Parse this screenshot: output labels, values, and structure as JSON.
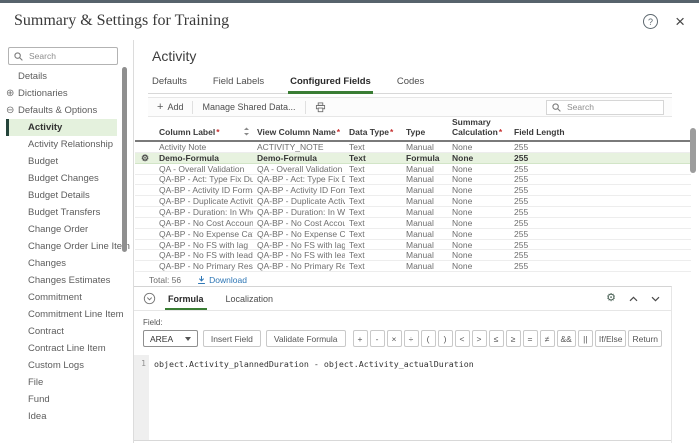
{
  "window": {
    "title": "Summary & Settings for Training"
  },
  "colors": {
    "accent_green": "#3a7d34",
    "selected_row_bg": "#e7f2df",
    "link_blue": "#2d76b5",
    "required_red": "#c62f2f",
    "selection_bar": "#25443b"
  },
  "sidebar": {
    "search_placeholder": "Search",
    "items": [
      {
        "label": "Details",
        "level": 1
      },
      {
        "label": "Dictionaries",
        "level": 1,
        "icon": "plus-circle"
      },
      {
        "label": "Defaults & Options",
        "level": 1,
        "icon": "minus-circle"
      },
      {
        "label": "Activity",
        "level": 2,
        "selected": true
      },
      {
        "label": "Activity Relationship",
        "level": 2
      },
      {
        "label": "Budget",
        "level": 2
      },
      {
        "label": "Budget Changes",
        "level": 2
      },
      {
        "label": "Budget Details",
        "level": 2
      },
      {
        "label": "Budget Transfers",
        "level": 2
      },
      {
        "label": "Change Order",
        "level": 2
      },
      {
        "label": "Change Order Line Item",
        "level": 2
      },
      {
        "label": "Changes",
        "level": 2
      },
      {
        "label": "Changes Estimates",
        "level": 2
      },
      {
        "label": "Commitment",
        "level": 2
      },
      {
        "label": "Commitment Line Item",
        "level": 2
      },
      {
        "label": "Contract",
        "level": 2
      },
      {
        "label": "Contract Line Item",
        "level": 2
      },
      {
        "label": "Custom Logs",
        "level": 2
      },
      {
        "label": "File",
        "level": 2
      },
      {
        "label": "Fund",
        "level": 2
      },
      {
        "label": "Idea",
        "level": 2
      }
    ]
  },
  "main": {
    "title": "Activity",
    "tabs": [
      {
        "label": "Defaults"
      },
      {
        "label": "Field Labels"
      },
      {
        "label": "Configured Fields",
        "active": true
      },
      {
        "label": "Codes"
      }
    ],
    "toolbar": {
      "add_label": "Add",
      "manage_label": "Manage Shared Data...",
      "search_placeholder": "Search"
    },
    "table": {
      "columns": [
        {
          "label": "Column Label",
          "required": true,
          "sortable": true
        },
        {
          "label": "View Column Name",
          "required": true
        },
        {
          "label": "Data Type",
          "required": true
        },
        {
          "label": "Type"
        },
        {
          "label": "Summary Calculation",
          "required": true
        },
        {
          "label": "Field Length"
        }
      ],
      "rows": [
        {
          "cells": [
            "Activity Note",
            "ACTIVITY_NOTE",
            "Text",
            "Manual",
            "None",
            "255"
          ]
        },
        {
          "cells": [
            "Demo-Formula",
            "Demo-Formula",
            "Text",
            "Formula",
            "None",
            "255"
          ],
          "selected": true,
          "gear": true
        },
        {
          "cells": [
            "QA - Overall Validation",
            "QA - Overall Validation",
            "Text",
            "Manual",
            "None",
            "255"
          ]
        },
        {
          "cells": [
            "QA-BP - Act: Type Fix Dur & ...",
            "QA-BP - Act: Type Fix Du...",
            "Text",
            "Manual",
            "None",
            "255"
          ]
        },
        {
          "cells": [
            "QA-BP - Activity ID Format",
            "QA-BP - Activity ID Format",
            "Text",
            "Manual",
            "None",
            "255"
          ]
        },
        {
          "cells": [
            "QA-BP - Duplicate Activity N...",
            "QA-BP - Duplicate Activit...",
            "Text",
            "Manual",
            "None",
            "255"
          ]
        },
        {
          "cells": [
            "QA-BP - Duration: In Whole ...",
            "QA-BP - Duration: In Wh...",
            "Text",
            "Manual",
            "None",
            "255"
          ]
        },
        {
          "cells": [
            "QA-BP - No Cost Account",
            "QA-BP - No Cost Account",
            "Text",
            "Manual",
            "None",
            "255"
          ]
        },
        {
          "cells": [
            "QA-BP - No Expense Category",
            "QA-BP - No Expense Cat...",
            "Text",
            "Manual",
            "None",
            "255"
          ]
        },
        {
          "cells": [
            "QA-BP - No FS with lag",
            "QA-BP - No FS with lag",
            "Text",
            "Manual",
            "None",
            "255"
          ]
        },
        {
          "cells": [
            "QA-BP - No FS with lead",
            "QA-BP - No FS with lead",
            "Text",
            "Manual",
            "None",
            "255"
          ]
        },
        {
          "cells": [
            "QA-BP - No Primary Resource",
            "QA-BP - No Primary Res...",
            "Text",
            "Manual",
            "None",
            "255"
          ]
        }
      ],
      "total_label": "Total: 56",
      "download_label": "Download"
    }
  },
  "formula_panel": {
    "tabs": [
      {
        "label": "Formula",
        "active": true
      },
      {
        "label": "Localization"
      }
    ],
    "field_label": "Field:",
    "field_value": "AREA",
    "insert_button": "Insert Field",
    "validate_button": "Validate Formula",
    "operators": [
      "+",
      "-",
      "×",
      "÷",
      "(",
      ")",
      "<",
      ">",
      "≤",
      "≥",
      "=",
      "≠",
      "&&",
      "||",
      "If/Else",
      "Return"
    ],
    "editor": {
      "line_number": "1",
      "code": "object.Activity_plannedDuration - object.Activity_actualDuration"
    }
  }
}
